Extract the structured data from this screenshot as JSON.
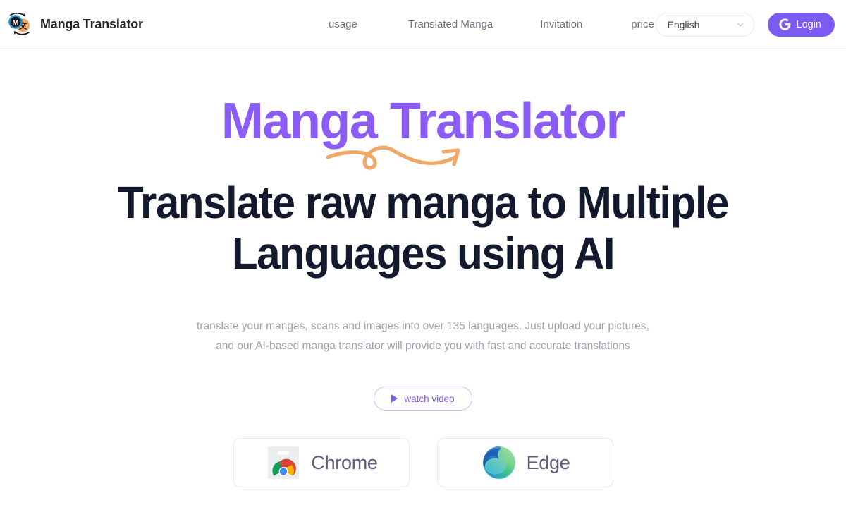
{
  "header": {
    "brand": {
      "name": "Manga Translator",
      "logo_icon": "manga-translator-logo-icon",
      "logo_blue_letter": "M",
      "logo_orange_letter": "文",
      "blue": "#2196d8",
      "orange": "#f0a868"
    },
    "nav": [
      {
        "label": "usage",
        "name": "nav-item-usage"
      },
      {
        "label": "Translated Manga",
        "name": "nav-item-translated-manga"
      },
      {
        "label": "Invitation",
        "name": "nav-item-invitation"
      },
      {
        "label": "price",
        "name": "nav-item-price"
      }
    ],
    "language_select": {
      "value": "English",
      "icon": "chevron-down-icon"
    },
    "login": {
      "label": "Login",
      "icon": "google-g-icon",
      "color": "#7c5cf0"
    }
  },
  "hero": {
    "title": "Manga Translator",
    "title_color": "#8b5cf6",
    "decoration_icon": "curved-arrow-swoosh-icon",
    "decoration_color": "#f0a868",
    "headline": "Translate raw manga to Multiple Languages using AI",
    "description": "translate your mangas, scans and images into over 135 languages. Just upload your pictures, and our AI-based manga translator will provide you with fast and accurate translations",
    "watch_video": {
      "label": "watch video",
      "icon": "play-icon",
      "color": "#7c5cf0"
    },
    "browsers": [
      {
        "label": "Chrome",
        "icon": "chrome-web-store-icon",
        "name": "chrome-extension-button"
      },
      {
        "label": "Edge",
        "icon": "microsoft-edge-icon",
        "name": "edge-extension-button"
      }
    ]
  }
}
